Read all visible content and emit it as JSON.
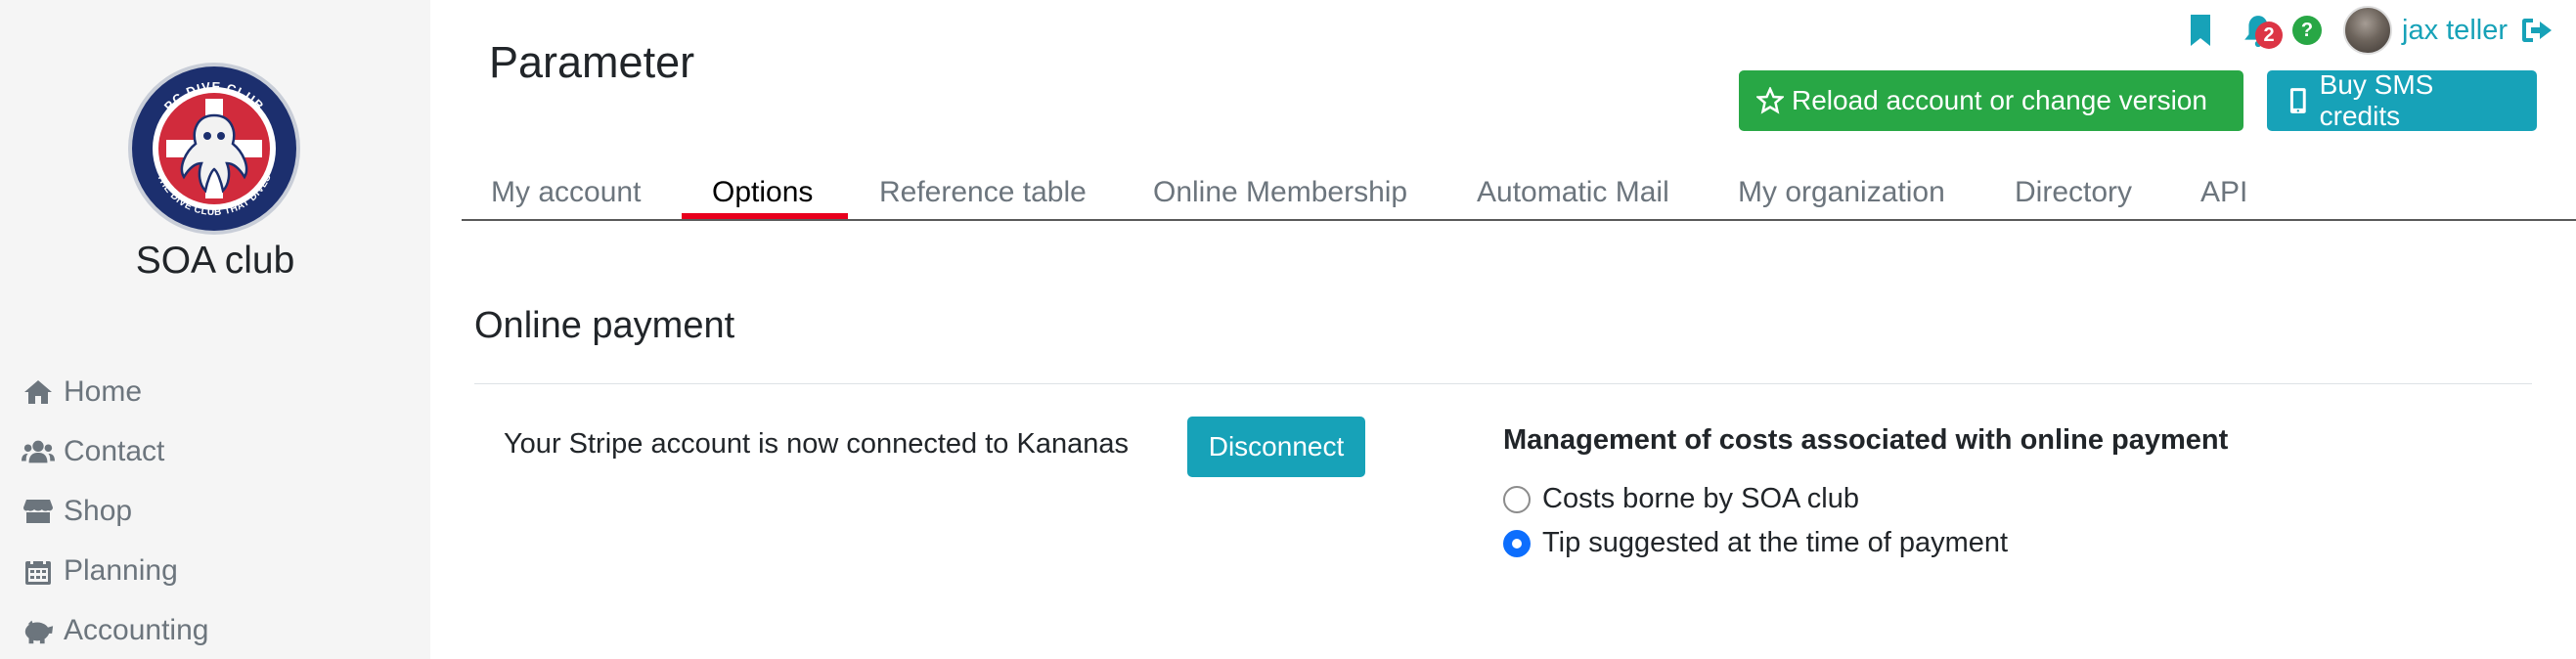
{
  "app": {
    "club_name": "SOA club",
    "logo_text_top": "PC DIVE CLUB",
    "logo_text_bottom": "THE DIVE CLUB THAT DIVES"
  },
  "sidebar": {
    "items": [
      {
        "label": "Home",
        "icon": "home-icon"
      },
      {
        "label": "Contact",
        "icon": "users-icon"
      },
      {
        "label": "Shop",
        "icon": "store-icon"
      },
      {
        "label": "Planning",
        "icon": "calendar-icon"
      },
      {
        "label": "Accounting",
        "icon": "piggy-bank-icon"
      }
    ]
  },
  "header": {
    "title": "Parameter",
    "notifications_count": "2",
    "help_label": "?",
    "username": "jax teller",
    "reload_button": "Reload account or change version",
    "sms_button": "Buy SMS credits"
  },
  "tabs": [
    {
      "label": "My account",
      "active": false
    },
    {
      "label": "Options",
      "active": true
    },
    {
      "label": "Reference table",
      "active": false
    },
    {
      "label": "Online Membership",
      "active": false
    },
    {
      "label": "Automatic Mail",
      "active": false
    },
    {
      "label": "My organization",
      "active": false
    },
    {
      "label": "Directory",
      "active": false
    },
    {
      "label": "API",
      "active": false
    }
  ],
  "main": {
    "section_title": "Online payment",
    "stripe_status": "Your Stripe account is now connected to Kananas",
    "disconnect_button": "Disconnect",
    "costs_title": "Management of costs associated with online payment",
    "options": [
      {
        "label": "Costs borne by SOA club",
        "selected": false
      },
      {
        "label": "Tip suggested at the time of payment",
        "selected": true
      }
    ]
  },
  "colors": {
    "accent": "#17a2b8",
    "success": "#28a745",
    "danger": "#dc3545",
    "active_tab_underline": "#e8001c",
    "radio_checked": "#0d6efd"
  }
}
